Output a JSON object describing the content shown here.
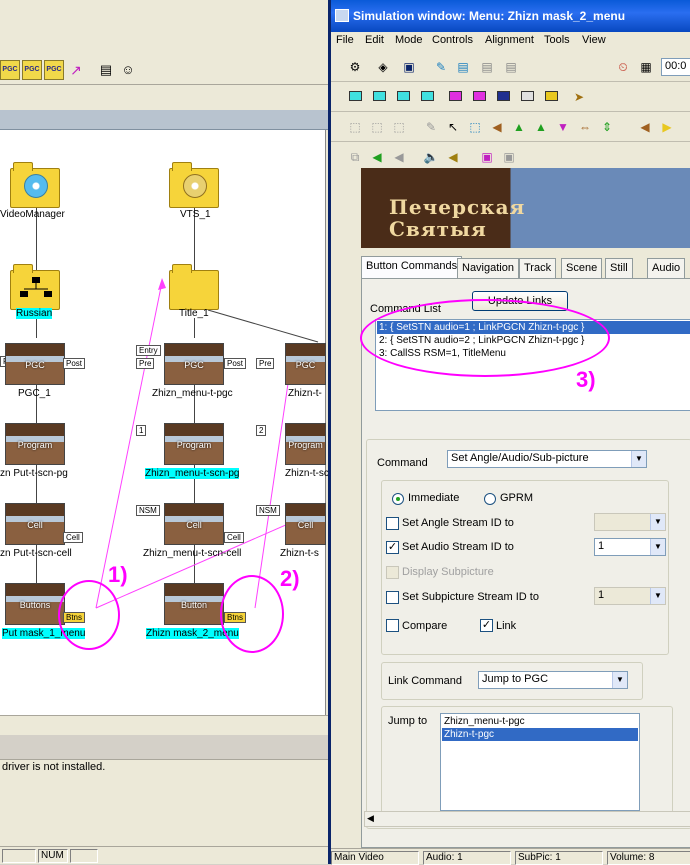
{
  "left": {
    "nodes": {
      "videomanager": "VideoManager",
      "vts": "VTS_1",
      "russian": "Russian",
      "title": "Title_1",
      "pgc1": "PGC_1",
      "pgc2": "Zhizn_menu-t-pgc",
      "pgc3": "Zhizn-t-",
      "program1": "zn Put-t-scn-pg",
      "program2": "Zhizn_menu-t-scn-pg",
      "program3": "Zhizn-t-sc",
      "cell1": "zn Put-t-scn-cell",
      "cell2": "Zhizn_menu-t-scn-cell",
      "cell3": "Zhizn-t-s",
      "btn1": "Put mask_1_menu",
      "btn2": "Zhizn mask_2_menu"
    },
    "thumbs": {
      "pgc": "PGC",
      "program": "Program",
      "cell": "Cell",
      "buttons": "Buttons",
      "button": "Button"
    },
    "tags": {
      "post": "Post",
      "entry": "Entry",
      "pre": "Pre",
      "one": "1",
      "two": "2",
      "nsm": "NSM",
      "cell": "Cell",
      "btns": "Btns"
    },
    "message": "driver is not installed.",
    "status_num": "NUM",
    "toolbar": {
      "pgc": "PGC"
    }
  },
  "annotations": {
    "one": "1)",
    "two": "2)",
    "three": "3)"
  },
  "sim": {
    "title": "Simulation window: Menu: Zhizn mask_2_menu",
    "menu": [
      "File",
      "Edit",
      "Mode",
      "Controls",
      "Alignment",
      "Tools",
      "View"
    ],
    "time": "00:0",
    "preview_text": "Печерская\nСвятыя",
    "tabs": [
      "Button Commands",
      "Navigation",
      "Track",
      "Scene",
      "Still",
      "Audio"
    ],
    "command_list_label": "Command List",
    "update_links": "Update Links",
    "commands": [
      "1: { SetSTN audio=1 ; LinkPGCN Zhizn-t-pgc }",
      "2: { SetSTN audio=2 ; LinkPGCN Zhizn-t-pgc }",
      "3: CallSS RSM=1, TitleMenu"
    ],
    "command_label": "Command",
    "command_value": "Set Angle/Audio/Sub-picture",
    "immediate": "Immediate",
    "gprm": "GPRM",
    "set_angle": "Set Angle Stream ID to",
    "set_audio": "Set Audio Stream ID to",
    "audio_value": "1",
    "display_subpicture": "Display Subpicture",
    "set_subpicture": "Set Subpicture Stream ID to",
    "subpicture_value": "1",
    "compare": "Compare",
    "link": "Link",
    "check_mark": "✓",
    "link_command_label": "Link Command",
    "link_command_value": "Jump to PGC",
    "jump_to_label": "Jump to",
    "jump_items": [
      "Zhizn_menu-t-pgc",
      "Zhizn-t-pgc"
    ],
    "status": {
      "main": "Main Video",
      "audio": "Audio: 1",
      "subpic": "SubPic: 1",
      "volume": "Volume: 8"
    }
  }
}
